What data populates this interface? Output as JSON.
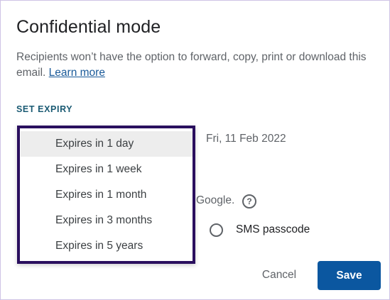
{
  "dialog": {
    "title": "Confidential mode",
    "description": "Recipients won’t have the option to forward, copy, print or download this email.",
    "learn_more": "Learn more"
  },
  "expiry": {
    "section_label": "SET EXPIRY",
    "date_text": "Fri, 11 Feb 2022",
    "selected_option": "Expires in 1 day",
    "options": [
      "Expires in 1 day",
      "Expires in 1 week",
      "Expires in 1 month",
      "Expires in 3 months",
      "Expires in 5 years"
    ]
  },
  "passcode": {
    "google_text": "Google.",
    "help_icon": "question-circle-icon",
    "sms_label": "SMS passcode"
  },
  "actions": {
    "cancel_label": "Cancel",
    "save_label": "Save"
  },
  "colors": {
    "accent": "#0b57a0",
    "dropdown_border": "#2a0f5e",
    "section_label": "#1a5a73"
  }
}
